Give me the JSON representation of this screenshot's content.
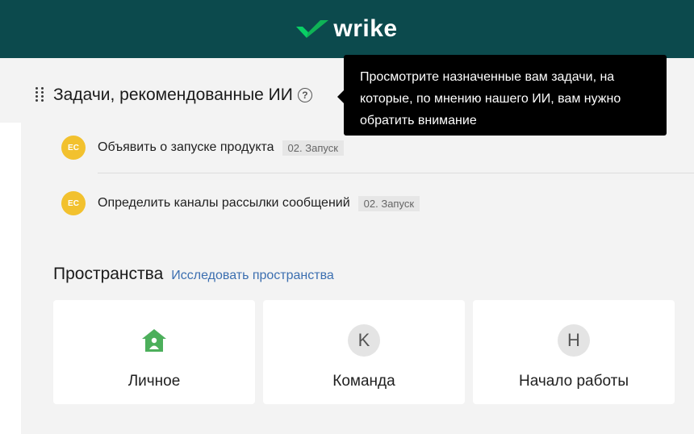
{
  "header": {
    "brand": "wrike",
    "brand_color": "#0c4a4d",
    "logo_icon": "wrike-checkmark-icon"
  },
  "ai_tasks": {
    "title": "Задачи, рекомендованные ИИ",
    "help_glyph": "?",
    "tooltip": "Просмотрите назначенные вам задачи, на которые, по мнению нашего ИИ, вам нужно обратить внимание",
    "items": [
      {
        "avatar": "EC",
        "name": "Объявить о запуске продукта",
        "tag": "02. Запуск"
      },
      {
        "avatar": "EC",
        "name": "Определить каналы рассылки сообщений",
        "tag": "02. Запуск"
      }
    ]
  },
  "spaces": {
    "title": "Пространства",
    "link": "Исследовать пространства",
    "cards": [
      {
        "icon": "home-icon",
        "label": "Личное"
      },
      {
        "icon": "letter-avatar",
        "letter": "K",
        "label": "Команда"
      },
      {
        "icon": "letter-avatar",
        "letter": "H",
        "label": "Начало работы"
      }
    ]
  },
  "colors": {
    "accent_link": "#3c6fb0",
    "avatar_yellow": "#f2c12e",
    "home_green": "#4caf5b"
  }
}
